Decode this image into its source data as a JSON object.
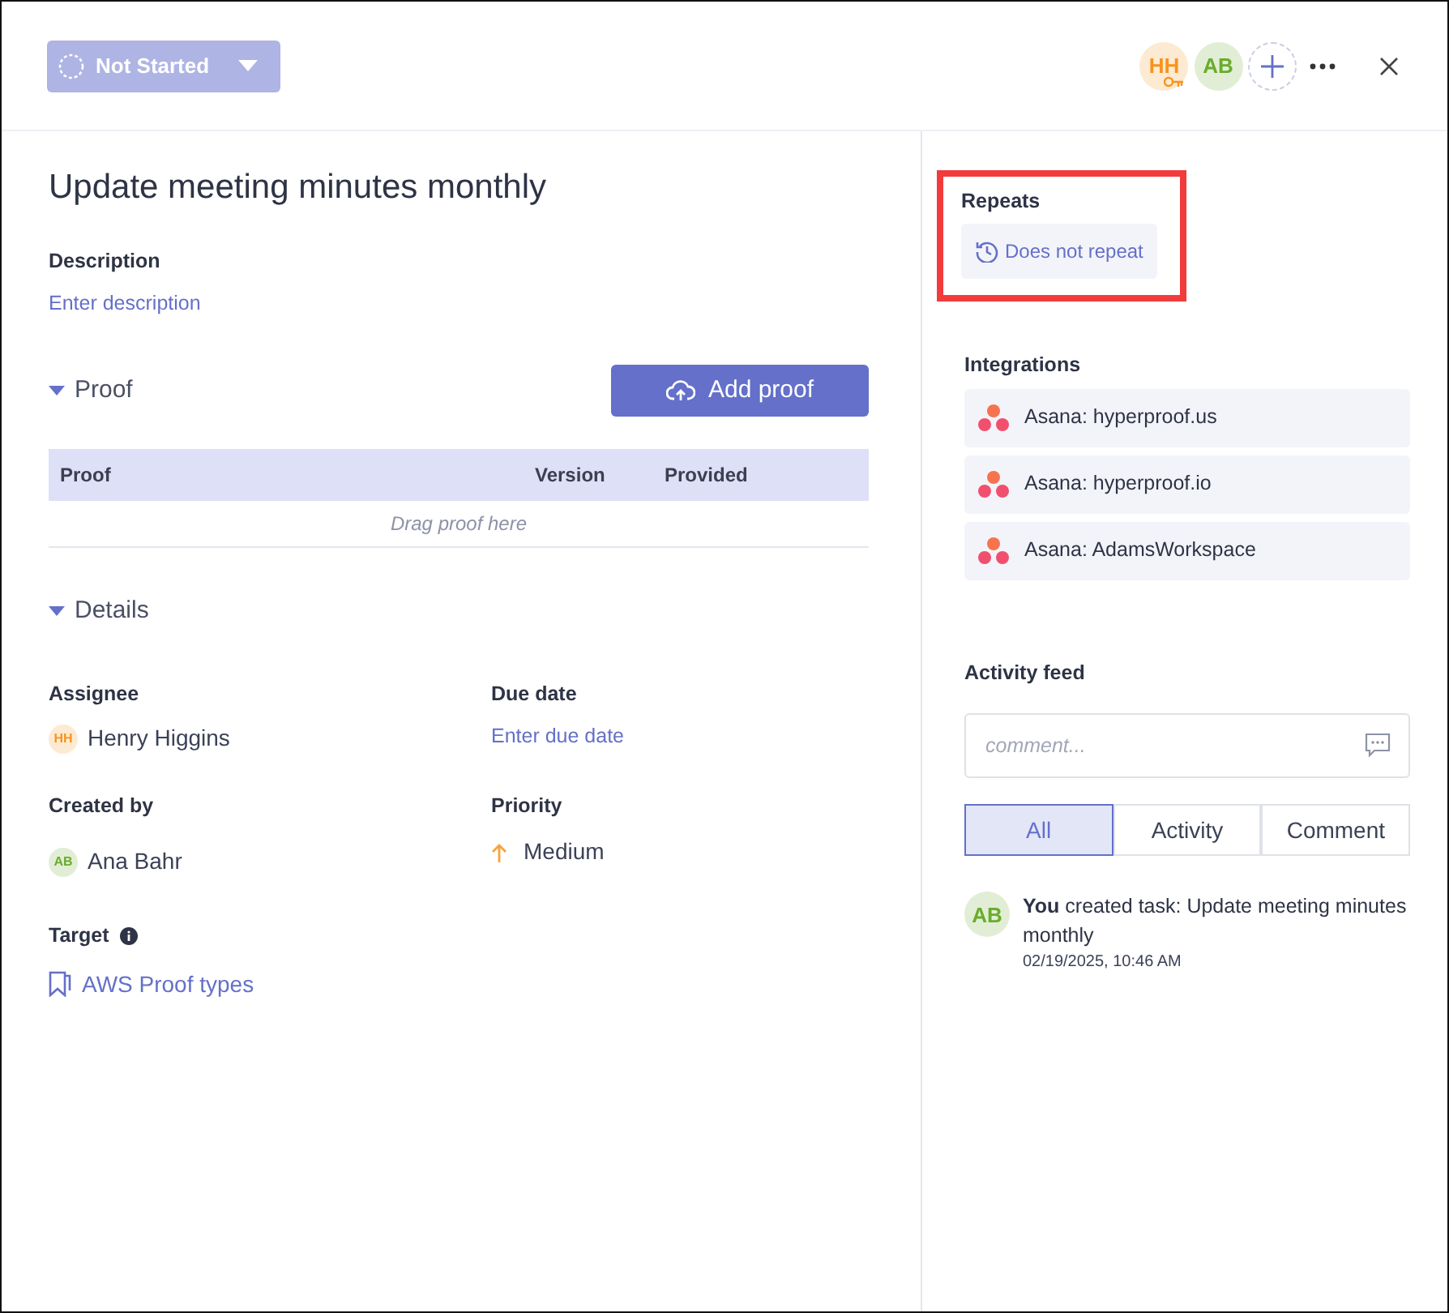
{
  "status_button": {
    "label": "Not Started"
  },
  "header_avatars": [
    {
      "initials": "HH",
      "color": "#f7941d",
      "owner": true
    },
    {
      "initials": "AB",
      "color": "#6aac2c",
      "owner": false
    }
  ],
  "title": "Update meeting minutes monthly",
  "description": {
    "label": "Description",
    "placeholder": "Enter description"
  },
  "proof": {
    "title": "Proof",
    "expanded": true,
    "button": "Add proof",
    "columns": [
      "Proof",
      "Version",
      "Provided"
    ],
    "empty_text": "Drag proof here"
  },
  "details": {
    "title": "Details",
    "expanded": true,
    "fields": [
      {
        "kind": "person",
        "label": "Assignee",
        "initials": "HH",
        "color": "#f7941d",
        "value": "Henry Higgins"
      },
      {
        "kind": "link",
        "label": "Due date",
        "value": "Enter due date"
      },
      {
        "kind": "person",
        "label": "Created by",
        "initials": "AB",
        "color": "#6aac2c",
        "value": "Ana Bahr"
      },
      {
        "kind": "priority",
        "label": "Priority",
        "value": "Medium"
      }
    ]
  },
  "target": {
    "label": "Target",
    "value": "AWS Proof types"
  },
  "repeats": {
    "label": "Repeats",
    "value": "Does not repeat",
    "highlighted": true
  },
  "integrations": {
    "label": "Integrations",
    "items": [
      "Asana: hyperproof.us",
      "Asana: hyperproof.io",
      "Asana: AdamsWorkspace"
    ]
  },
  "activity": {
    "label": "Activity feed",
    "placeholder": "comment...",
    "filters": [
      {
        "label": "All",
        "selected": true
      },
      {
        "label": "Activity",
        "selected": false
      },
      {
        "label": "Comment",
        "selected": false
      }
    ],
    "entries": [
      {
        "initials": "AB",
        "color": "#6aac2c",
        "text": "**You** created task: Update meeting minutes monthly",
        "time": "02/19/2025, 10:46 AM"
      }
    ]
  }
}
